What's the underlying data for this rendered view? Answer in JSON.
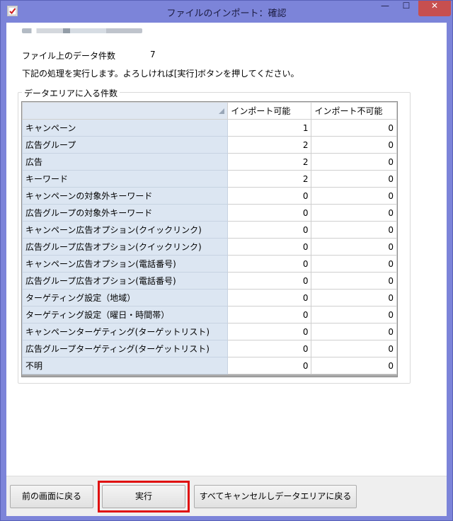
{
  "window": {
    "title": "ファイルのインポート：確認",
    "controls": {
      "minimize": "—",
      "maximize": "☐",
      "close": "✕"
    }
  },
  "summary": {
    "file_count_label": "ファイル上のデータ件数",
    "file_count_value": "7",
    "instruction": "下記の処理を実行します。よろしければ[実行]ボタンを押してください。"
  },
  "group": {
    "title": "データエリアに入る件数",
    "columns": [
      "インポート可能",
      "インポート不可能"
    ],
    "rows": [
      {
        "label": "キャンペーン",
        "importable": "1",
        "not_importable": "0"
      },
      {
        "label": "広告グループ",
        "importable": "2",
        "not_importable": "0"
      },
      {
        "label": "広告",
        "importable": "2",
        "not_importable": "0"
      },
      {
        "label": "キーワード",
        "importable": "2",
        "not_importable": "0"
      },
      {
        "label": "キャンペーンの対象外キーワード",
        "importable": "0",
        "not_importable": "0"
      },
      {
        "label": "広告グループの対象外キーワード",
        "importable": "0",
        "not_importable": "0"
      },
      {
        "label": "キャンペーン広告オプション(クイックリンク)",
        "importable": "0",
        "not_importable": "0"
      },
      {
        "label": "広告グループ広告オプション(クイックリンク)",
        "importable": "0",
        "not_importable": "0"
      },
      {
        "label": "キャンペーン広告オプション(電話番号)",
        "importable": "0",
        "not_importable": "0"
      },
      {
        "label": "広告グループ広告オプション(電話番号)",
        "importable": "0",
        "not_importable": "0"
      },
      {
        "label": "ターゲティング設定（地域）",
        "importable": "0",
        "not_importable": "0"
      },
      {
        "label": "ターゲティング設定（曜日・時間帯）",
        "importable": "0",
        "not_importable": "0"
      },
      {
        "label": "キャンペーンターゲティング(ターゲットリスト)",
        "importable": "0",
        "not_importable": "0"
      },
      {
        "label": "広告グループターゲティング(ターゲットリスト)",
        "importable": "0",
        "not_importable": "0"
      },
      {
        "label": "不明",
        "importable": "0",
        "not_importable": "0"
      }
    ]
  },
  "footer": {
    "back_label": "前の画面に戻る",
    "execute_label": "実行",
    "cancel_all_label": "すべてキャンセルしデータエリアに戻る"
  },
  "colors": {
    "frame": "#7c84d9",
    "row_header": "#dce6f2",
    "highlight": "#e01010"
  }
}
